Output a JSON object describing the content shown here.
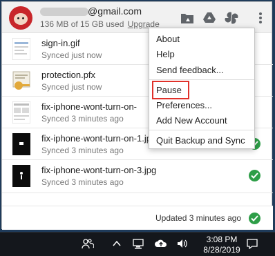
{
  "account": {
    "email_suffix": "@gmail.com",
    "quota_text": "136 MB of 15 GB used",
    "upgrade_label": "Upgrade"
  },
  "header_icons": [
    "drive-folder-icon",
    "google-drive-icon",
    "google-photos-icon",
    "more-vert-icon"
  ],
  "files": [
    {
      "name": "sign-in.gif",
      "status": "Synced just now",
      "thumb": "gif-thumbnail"
    },
    {
      "name": "protection.pfx",
      "status": "Synced just now",
      "thumb": "certificate-file-icon"
    },
    {
      "name": "fix-iphone-wont-turn-on-",
      "status": "Synced 3 minutes ago",
      "thumb": "screenshot-thumbnail"
    },
    {
      "name": "fix-iphone-wont-turn-on-1.jpg",
      "status": "Synced 3 minutes ago",
      "thumb": "phone-image-thumbnail"
    },
    {
      "name": "fix-iphone-wont-turn-on-3.jpg",
      "status": "Synced 3 minutes ago",
      "thumb": "phone-image-thumbnail"
    }
  ],
  "footer": {
    "status_text": "Updated 3 minutes ago"
  },
  "menu": {
    "items": [
      "About",
      "Help",
      "Send feedback...",
      "Pause",
      "Preferences...",
      "Add New Account",
      "Quit Backup and Sync"
    ],
    "highlighted": "Pause"
  },
  "taskbar": {
    "time": "3:08 PM",
    "date": "8/28/2019",
    "icons": [
      "people-icon",
      "chevron-up-icon",
      "network-icon",
      "cloud-upload-icon",
      "volume-icon",
      "notification-icon"
    ]
  },
  "colors": {
    "success_green": "#2e9e48",
    "highlight_red": "#e0312a",
    "taskbar_bg": "#14171c"
  }
}
